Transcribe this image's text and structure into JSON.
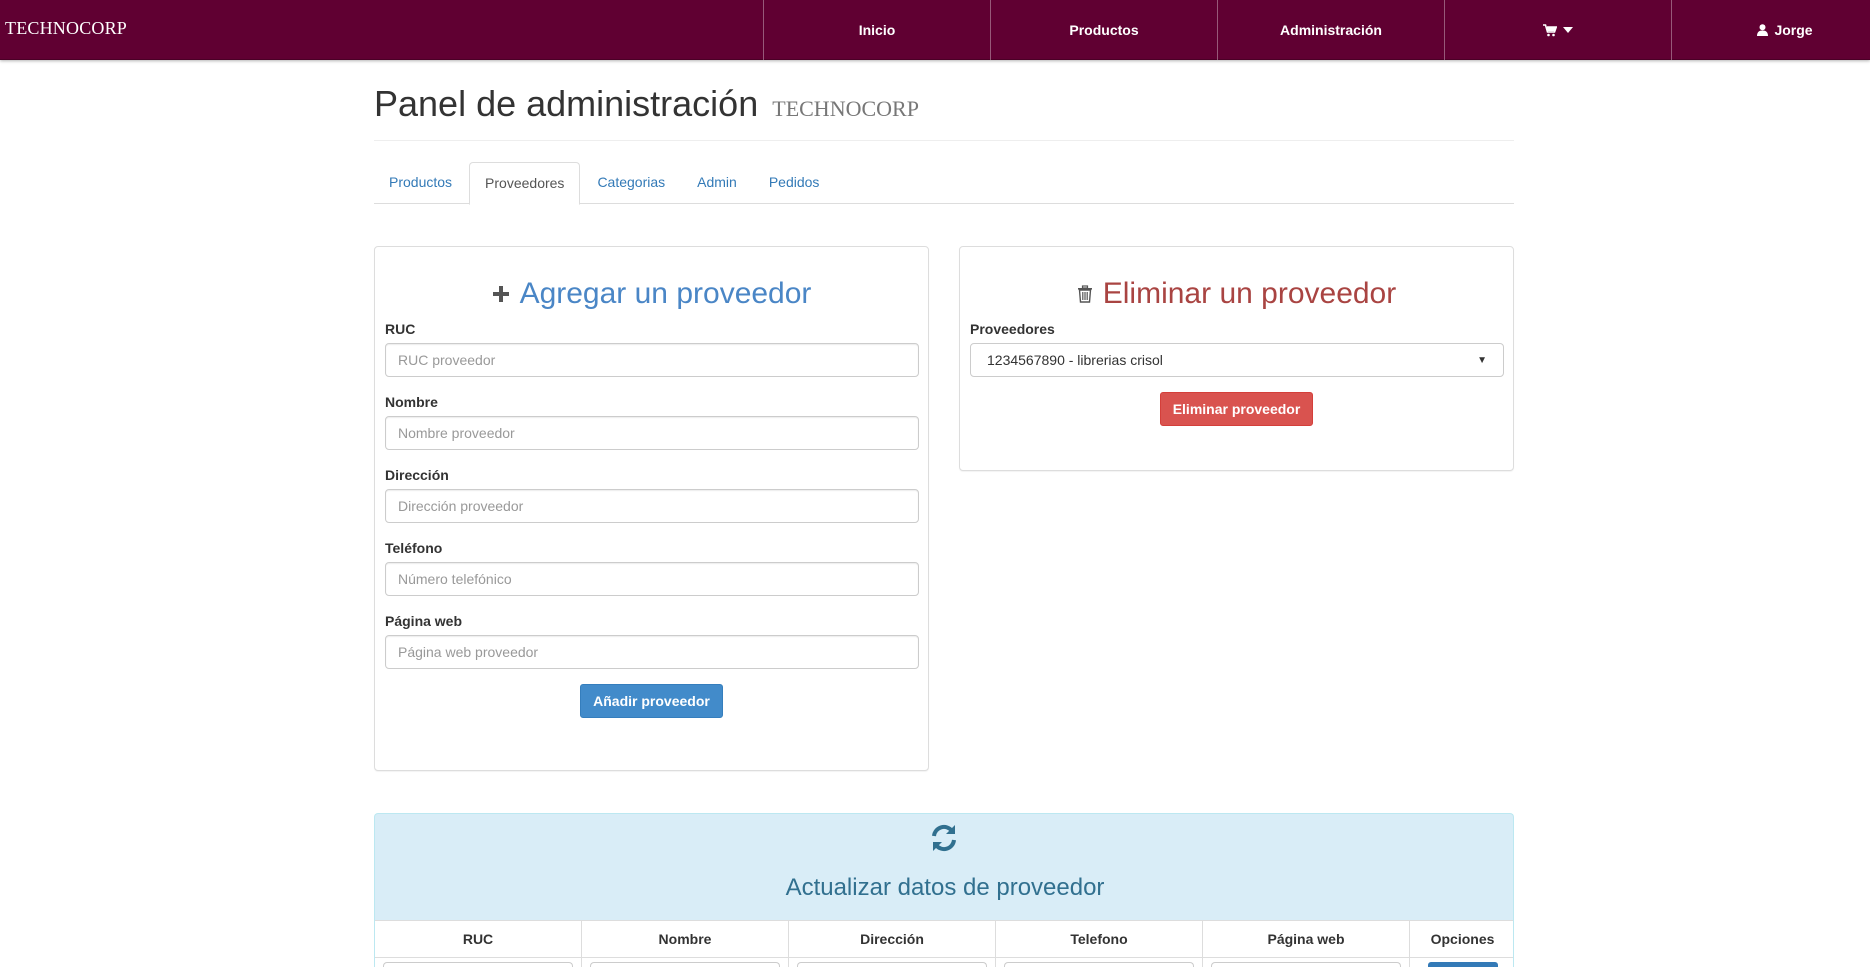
{
  "navbar": {
    "brand": "TECHNOCORP",
    "items": [
      {
        "label": "Inicio"
      },
      {
        "label": "Productos"
      },
      {
        "label": "Administración"
      },
      {
        "label": ""
      },
      {
        "label": "Jorge"
      }
    ],
    "cart_icon": "shopping-cart-icon",
    "user_icon": "user-icon",
    "caret_icon": "caret-down-icon"
  },
  "header": {
    "title": "Panel de administración",
    "subtitle": "TECHNOCORP"
  },
  "tabs": [
    {
      "label": "Productos",
      "active": false
    },
    {
      "label": "Proveedores",
      "active": true
    },
    {
      "label": "Categorias",
      "active": false
    },
    {
      "label": "Admin",
      "active": false
    },
    {
      "label": "Pedidos",
      "active": false
    }
  ],
  "add_panel": {
    "title": "Agregar un proveedor",
    "icon": "plus-icon",
    "fields": [
      {
        "label": "RUC",
        "placeholder": "RUC proveedor"
      },
      {
        "label": "Nombre",
        "placeholder": "Nombre proveedor"
      },
      {
        "label": "Dirección",
        "placeholder": "Dirección proveedor"
      },
      {
        "label": "Teléfono",
        "placeholder": "Número telefónico"
      },
      {
        "label": "Página web",
        "placeholder": "Página web proveedor"
      }
    ],
    "submit_label": "Añadir proveedor"
  },
  "delete_panel": {
    "title": "Eliminar un proveedor",
    "icon": "trash-icon",
    "select_label": "Proveedores",
    "selected_value": "1234567890 - librerias crisol",
    "submit_label": "Eliminar proveedor"
  },
  "update_panel": {
    "title": "Actualizar datos de proveedor",
    "icon": "refresh-icon",
    "columns": [
      "RUC",
      "Nombre",
      "Dirección",
      "Telefono",
      "Página web",
      "Opciones"
    ]
  },
  "colors": {
    "navbar": "#600032",
    "primary": "#428bca",
    "danger": "#d9534f",
    "info_bg": "#d9edf7",
    "info_text": "#31708f"
  }
}
